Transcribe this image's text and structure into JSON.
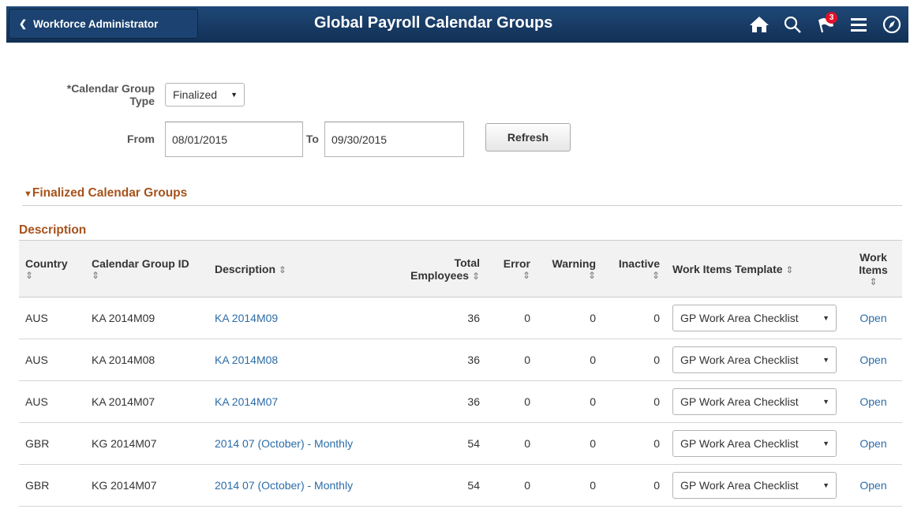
{
  "header": {
    "back_label": "Workforce Administrator",
    "title": "Global Payroll Calendar Groups",
    "notification_count": "3"
  },
  "form": {
    "group_type_label_line1": "*Calendar Group",
    "group_type_label_line2": "Type",
    "group_type_value": "Finalized",
    "from_label": "From",
    "from_value": "08/01/2015",
    "to_label": "To",
    "to_value": "09/30/2015",
    "refresh_label": "Refresh"
  },
  "section": {
    "title": "Finalized Calendar Groups",
    "grid_title": "Description"
  },
  "columns": {
    "country": "Country",
    "group_id": "Calendar Group ID",
    "description": "Description",
    "total_line1": "Total",
    "total_line2": "Employees",
    "error": "Error",
    "warning": "Warning",
    "inactive": "Inactive",
    "template": "Work Items Template",
    "work_items_line1": "Work",
    "work_items_line2": "Items"
  },
  "rows": [
    {
      "country": "AUS",
      "group_id": "KA 2014M09",
      "description": "KA 2014M09",
      "total": "36",
      "error": "0",
      "warning": "0",
      "inactive": "0",
      "template": "GP Work Area Checklist",
      "action": "Open"
    },
    {
      "country": "AUS",
      "group_id": "KA 2014M08",
      "description": "KA 2014M08",
      "total": "36",
      "error": "0",
      "warning": "0",
      "inactive": "0",
      "template": "GP Work Area Checklist",
      "action": "Open"
    },
    {
      "country": "AUS",
      "group_id": "KA 2014M07",
      "description": "KA 2014M07",
      "total": "36",
      "error": "0",
      "warning": "0",
      "inactive": "0",
      "template": "GP Work Area Checklist",
      "action": "Open"
    },
    {
      "country": "GBR",
      "group_id": "KG 2014M07",
      "description": "2014 07 (October) - Monthly",
      "total": "54",
      "error": "0",
      "warning": "0",
      "inactive": "0",
      "template": "GP Work Area Checklist",
      "action": "Open"
    },
    {
      "country": "GBR",
      "group_id": "KG 2014M07",
      "description": "2014 07 (October) - Monthly",
      "total": "54",
      "error": "0",
      "warning": "0",
      "inactive": "0",
      "template": "GP Work Area Checklist",
      "action": "Open"
    }
  ],
  "icons": [
    "home-icon",
    "search-icon",
    "notifications-flag-icon",
    "menu-icon",
    "navbar-compass-icon"
  ],
  "colors": {
    "banner": "#17375e",
    "section_title": "#a6521b",
    "link": "#2c6ca8",
    "badge": "#e0112a"
  }
}
